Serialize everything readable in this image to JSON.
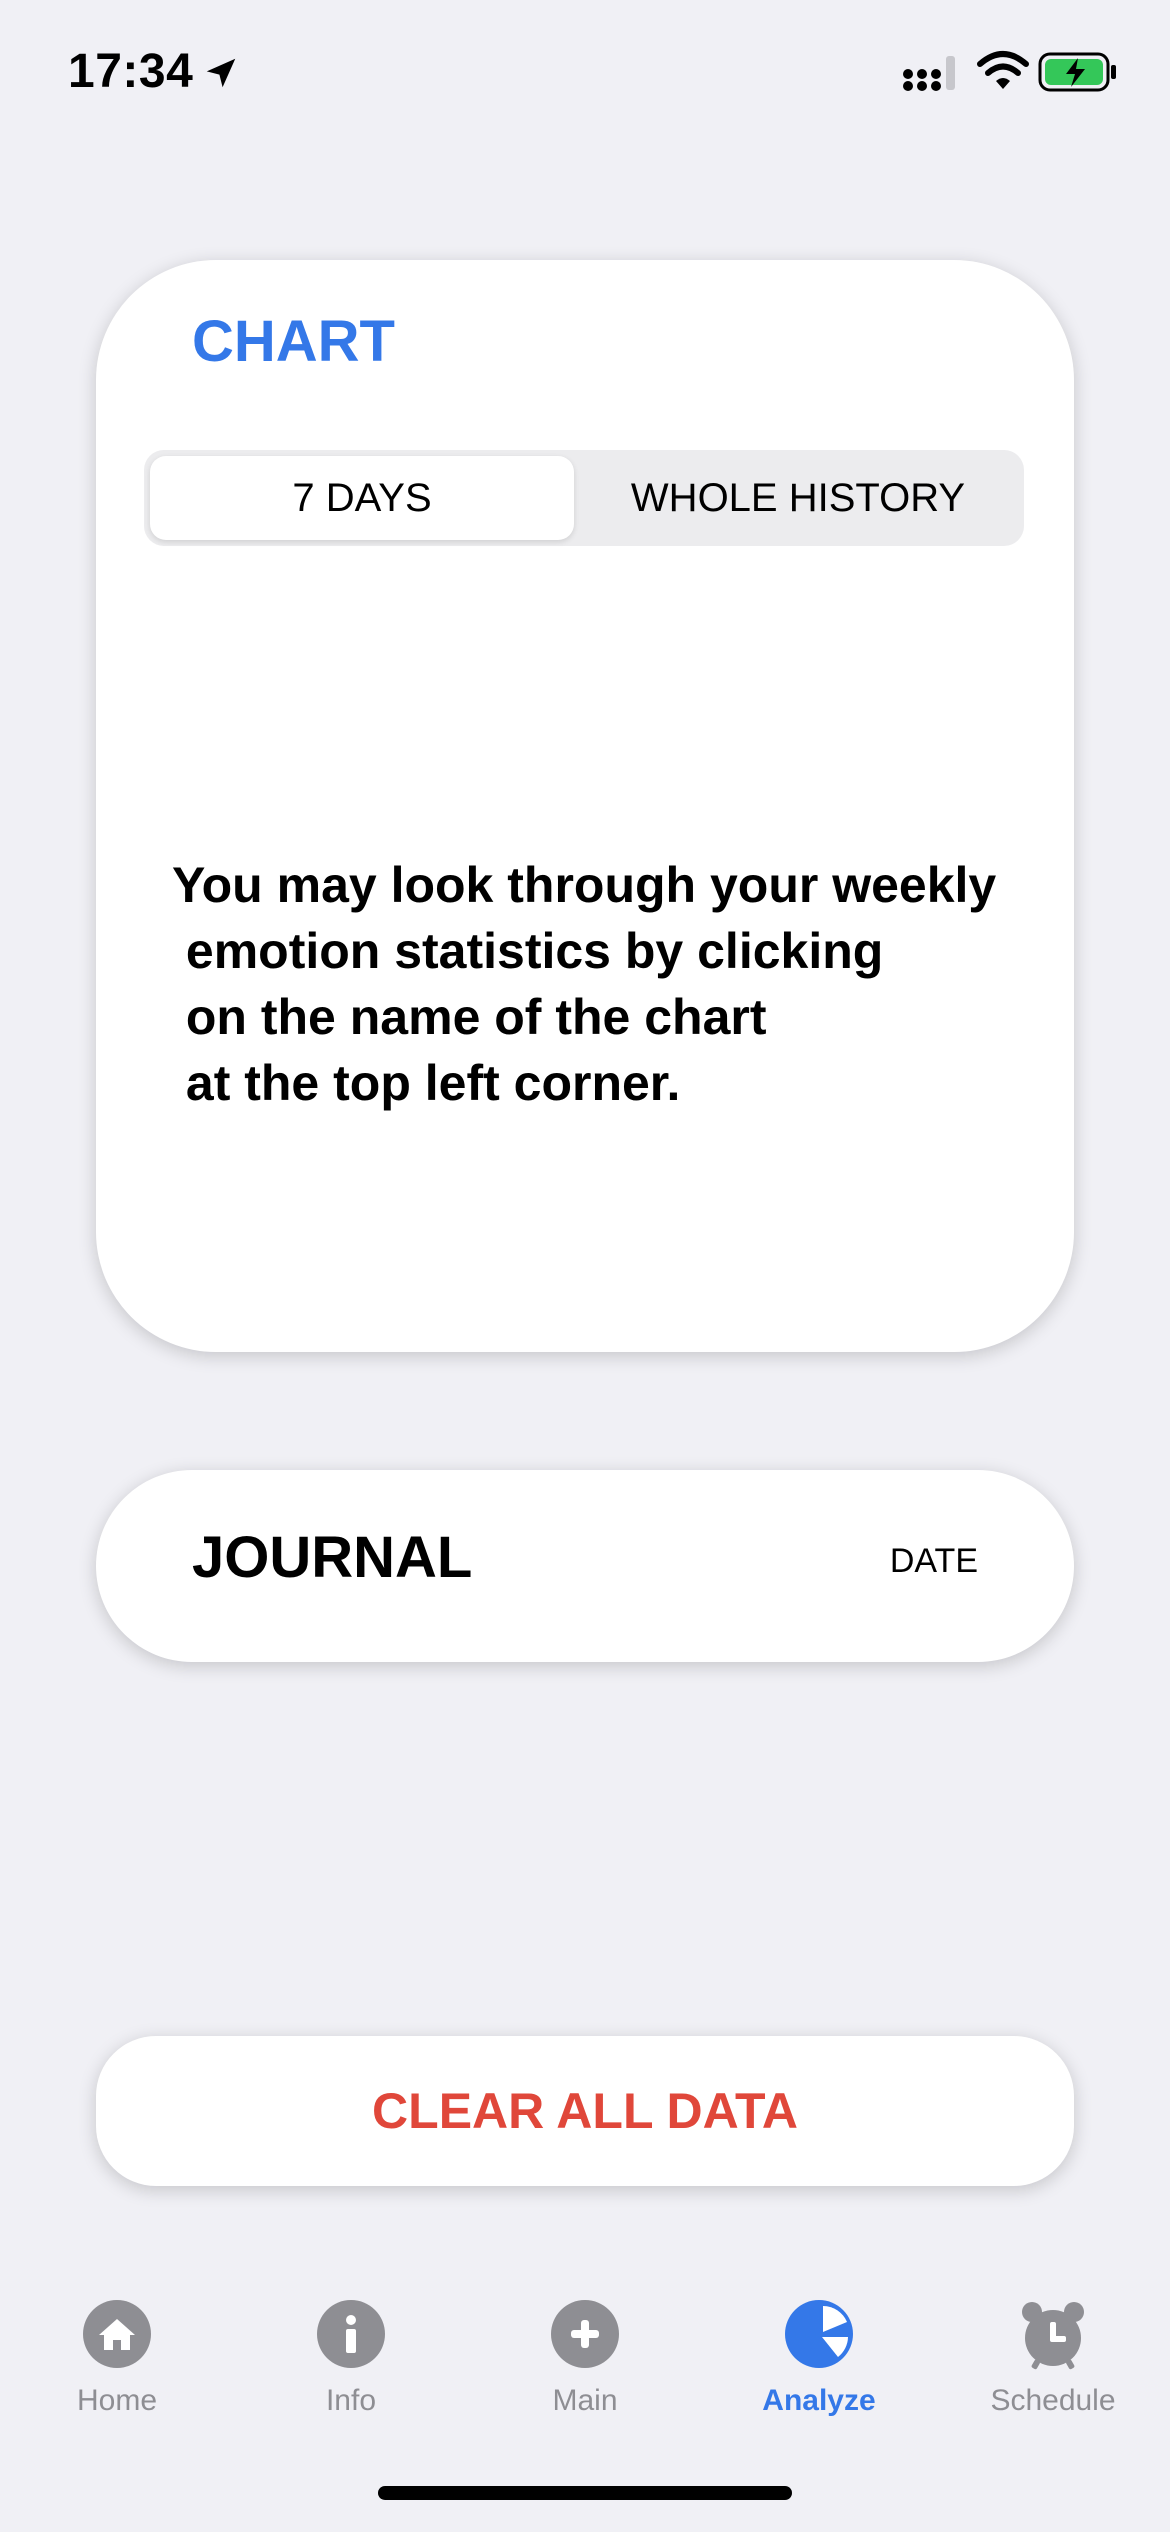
{
  "status": {
    "time": "17:34"
  },
  "chart": {
    "title": "CHART",
    "segments": [
      {
        "label": "7 DAYS",
        "selected": true
      },
      {
        "label": "WHOLE HISTORY",
        "selected": false
      }
    ],
    "message": "You may look through your weekly\n emotion statistics by clicking\n on the name of the chart\n at the top left corner."
  },
  "journal": {
    "title": "JOURNAL",
    "date_label": "DATE"
  },
  "actions": {
    "clear_label": "CLEAR ALL DATA"
  },
  "tabs": [
    {
      "label": "Home",
      "icon": "home-icon",
      "active": false
    },
    {
      "label": "Info",
      "icon": "info-icon",
      "active": false
    },
    {
      "label": "Main",
      "icon": "plus-icon",
      "active": false
    },
    {
      "label": "Analyze",
      "icon": "pie-chart-icon",
      "active": true
    },
    {
      "label": "Schedule",
      "icon": "alarm-clock-icon",
      "active": false
    }
  ],
  "colors": {
    "accent": "#3478e8",
    "danger": "#e0473a",
    "background": "#f0f0f5",
    "inactive_tab": "#8e8e93"
  }
}
